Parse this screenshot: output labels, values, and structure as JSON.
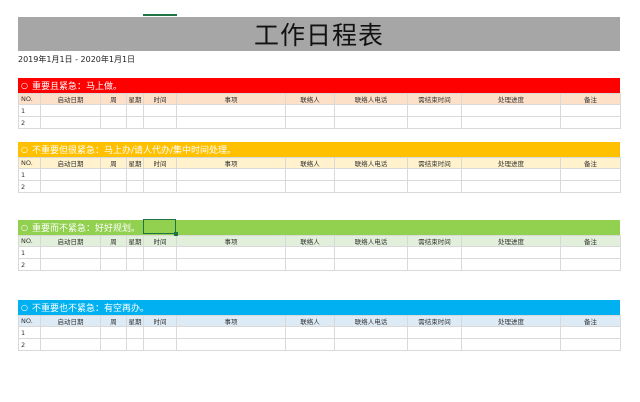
{
  "title": "工作日程表",
  "date_range": "2019年1月1日 - 2020年1月1日",
  "columns": [
    "NO.",
    "启动日期",
    "周",
    "星期",
    "时间",
    "事项",
    "联络人",
    "联络人电话",
    "需结束时间",
    "处理进度",
    "备注"
  ],
  "sections": [
    {
      "label": "重要且紧急：马上做。",
      "head_color": "#ff0000",
      "sub_color": "#fde0c8",
      "rows": [
        "1",
        "2"
      ]
    },
    {
      "label": "不重要但很紧急：马上办/请人代办/集中时间处理。",
      "head_color": "#ffc000",
      "sub_color": "#fff2cc",
      "rows": [
        "1",
        "2"
      ]
    },
    {
      "label": "重要而不紧急：好好规划。",
      "head_color": "#92d050",
      "sub_color": "#e2efda",
      "rows": [
        "1",
        "2"
      ]
    },
    {
      "label": "不重要也不紧急：有空再办。",
      "head_color": "#00b0f0",
      "sub_color": "#ddebf7",
      "rows": [
        "1",
        "2"
      ]
    }
  ]
}
